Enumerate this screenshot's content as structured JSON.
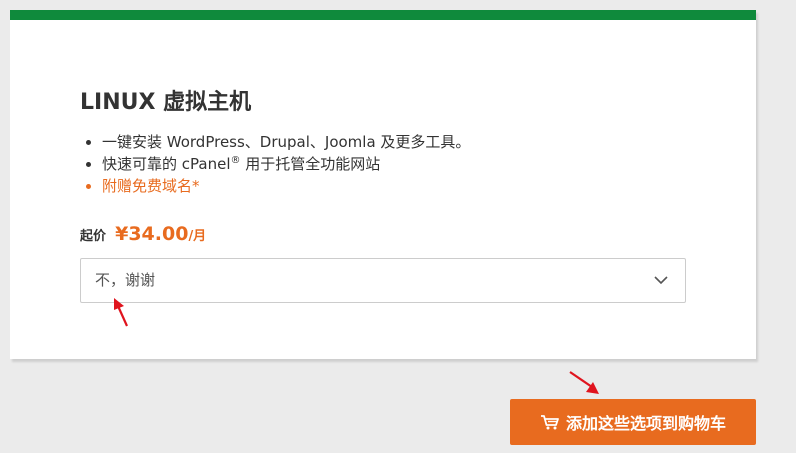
{
  "colors": {
    "brand_green": "#0f8a3c",
    "accent_orange": "#e86b1f",
    "arrow_red": "#e0141e",
    "background": "#ebebeb",
    "card_background": "#ffffff"
  },
  "product": {
    "title": "LINUX 虚拟主机",
    "features": [
      {
        "text": "一键安装 WordPress、Drupal、Joomla 及更多工具。",
        "highlight": false
      },
      {
        "text": "快速可靠的 cPanel",
        "sup": "®",
        "text_after": " 用于托管全功能网站",
        "highlight": false
      },
      {
        "text": "附赠免费域名*",
        "highlight": true
      }
    ],
    "price": {
      "label": "起价",
      "value": "¥34.00",
      "unit": "/月"
    }
  },
  "addon_select": {
    "selected": "不，谢谢",
    "icon": "chevron-down-icon"
  },
  "cart_button": {
    "label": "添加这些选项到购物车",
    "icon": "cart-icon"
  },
  "annotations": {
    "arrow_icon": "red-arrow-icon"
  }
}
